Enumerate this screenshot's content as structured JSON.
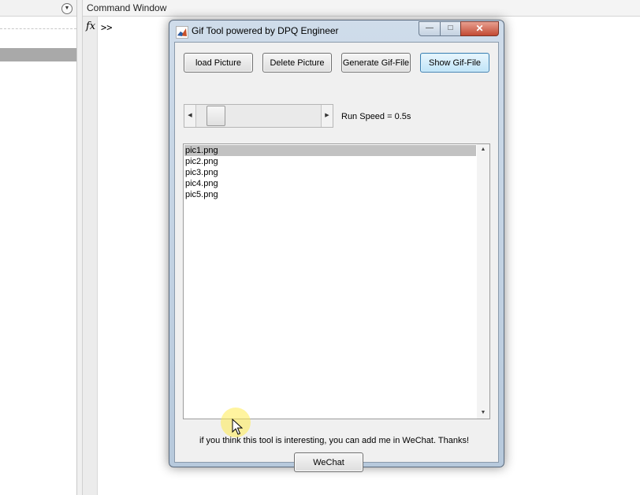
{
  "background": {
    "command_window_title": "Command Window",
    "fx_symbol": "fx",
    "prompt": ">>"
  },
  "dialog": {
    "title": "Gif Tool powered by DPQ Engineer",
    "window_controls": {
      "minimize": "—",
      "maximize": "□",
      "close": "✕"
    },
    "buttons": {
      "load": "load Picture",
      "delete": "Delete Picture",
      "generate": "Generate Gif-File",
      "show": "Show Gif-File"
    },
    "slider": {
      "value_fraction": 0.1
    },
    "speed_label": "Run Speed = 0.5s",
    "files": [
      "pic1.png",
      "pic2.png",
      "pic3.png",
      "pic4.png",
      "pic5.png"
    ],
    "selected_file": "pic1.png",
    "info": "if you think this tool is interesting, you can add me in WeChat. Thanks!",
    "wechat_button": "WeChat"
  },
  "icons": {
    "dropdown": "chevron-down-icon",
    "app": "matlab-icon",
    "cursor": "arrow-cursor-icon"
  },
  "colors": {
    "list_selection": "#c2c2c2",
    "active_button": "#bfe4f8",
    "close_button": "#c24a34",
    "cursor_highlight": "#ffeb50"
  }
}
